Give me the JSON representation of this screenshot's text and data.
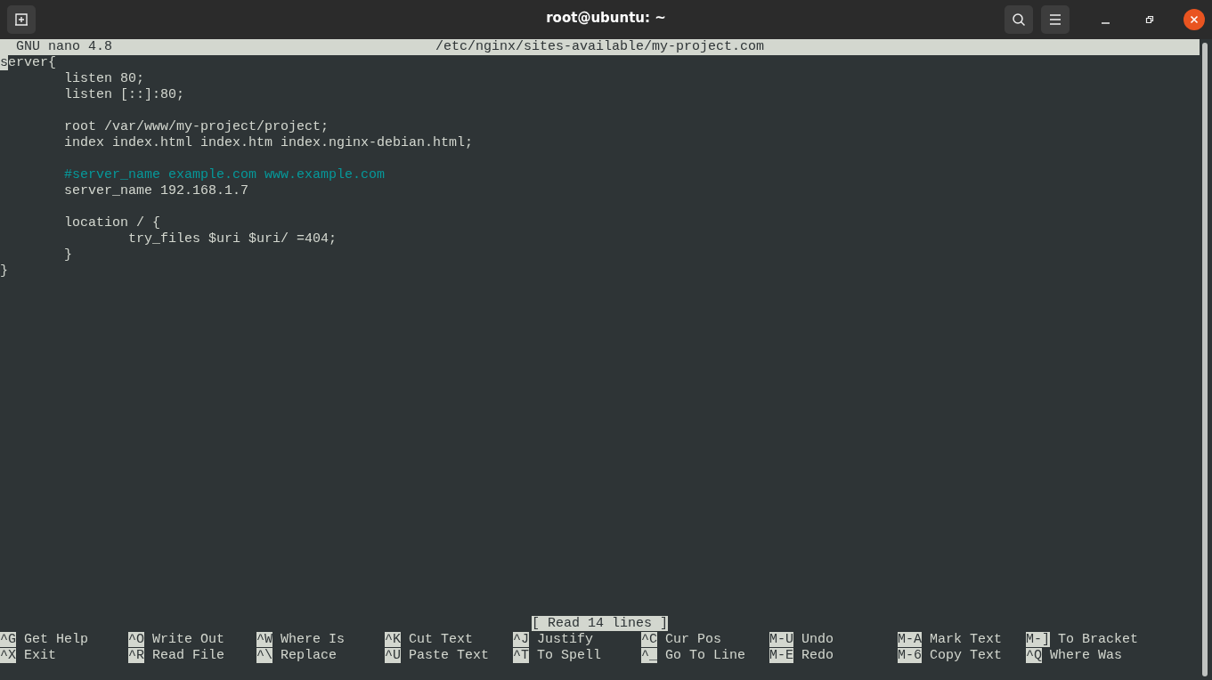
{
  "window": {
    "title": "root@ubuntu: ~"
  },
  "editor": {
    "name_version": "GNU nano 4.8",
    "file_path": "/etc/nginx/sites-available/my-project.com",
    "lines": [
      {
        "kind": "code",
        "text": "server{",
        "cursor": true
      },
      {
        "kind": "code",
        "text": "\tlisten 80;",
        "cursor": false
      },
      {
        "kind": "code",
        "text": "\tlisten [::]:80;",
        "cursor": false
      },
      {
        "kind": "blank",
        "cursor": false
      },
      {
        "kind": "code",
        "text": "\troot /var/www/my-project/project;",
        "cursor": false
      },
      {
        "kind": "code",
        "text": "\tindex index.html index.htm index.nginx-debian.html;",
        "cursor": false
      },
      {
        "kind": "blank",
        "cursor": false
      },
      {
        "kind": "comment",
        "text": "\t#server_name example.com www.example.com",
        "cursor": false
      },
      {
        "kind": "code",
        "text": "\tserver_name 192.168.1.7",
        "cursor": false
      },
      {
        "kind": "blank",
        "cursor": false
      },
      {
        "kind": "code",
        "text": "\tlocation / {",
        "cursor": false
      },
      {
        "kind": "code",
        "text": "\t\ttry_files $uri $uri/ =404;",
        "cursor": false
      },
      {
        "kind": "code",
        "text": "\t}",
        "cursor": false
      },
      {
        "kind": "code",
        "text": "}",
        "cursor": false
      }
    ],
    "status": "[ Read 14 lines ]",
    "shortcut_rows": [
      [
        {
          "key": "^G",
          "label": "Get Help"
        },
        {
          "key": "^O",
          "label": "Write Out"
        },
        {
          "key": "^W",
          "label": "Where Is"
        },
        {
          "key": "^K",
          "label": "Cut Text"
        },
        {
          "key": "^J",
          "label": "Justify"
        },
        {
          "key": "^C",
          "label": "Cur Pos"
        },
        {
          "key": "M-U",
          "label": "Undo"
        },
        {
          "key": "M-A",
          "label": "Mark Text"
        },
        {
          "key": "M-]",
          "label": "To Bracket"
        }
      ],
      [
        {
          "key": "^X",
          "label": "Exit"
        },
        {
          "key": "^R",
          "label": "Read File"
        },
        {
          "key": "^\\",
          "label": "Replace"
        },
        {
          "key": "^U",
          "label": "Paste Text"
        },
        {
          "key": "^T",
          "label": "To Spell"
        },
        {
          "key": "^_",
          "label": "Go To Line"
        },
        {
          "key": "M-E",
          "label": "Redo"
        },
        {
          "key": "M-6",
          "label": "Copy Text"
        },
        {
          "key": "^Q",
          "label": "Where Was"
        }
      ]
    ]
  }
}
